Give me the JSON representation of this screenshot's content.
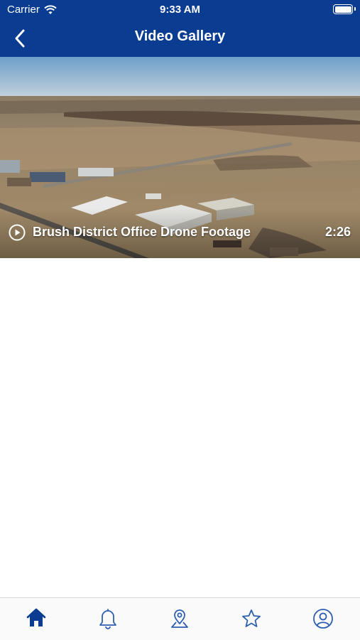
{
  "status_bar": {
    "carrier": "Carrier",
    "time": "9:33 AM",
    "icons": [
      "wifi-icon",
      "battery-icon"
    ]
  },
  "nav": {
    "title": "Video Gallery",
    "back_icon": "chevron-left-icon"
  },
  "videos": [
    {
      "title": "Brush District Office Drone Footage",
      "duration": "2:26",
      "play_icon": "play-circle-icon"
    }
  ],
  "tab_bar": {
    "tabs": [
      {
        "icon": "home-icon",
        "active": true
      },
      {
        "icon": "bell-icon",
        "active": false
      },
      {
        "icon": "map-pin-icon",
        "active": false
      },
      {
        "icon": "star-icon",
        "active": false
      },
      {
        "icon": "profile-icon",
        "active": false
      }
    ]
  },
  "colors": {
    "primary": "#0a3d91",
    "tab_active": "#0a3d91",
    "tab_inactive": "#2e5fae"
  }
}
